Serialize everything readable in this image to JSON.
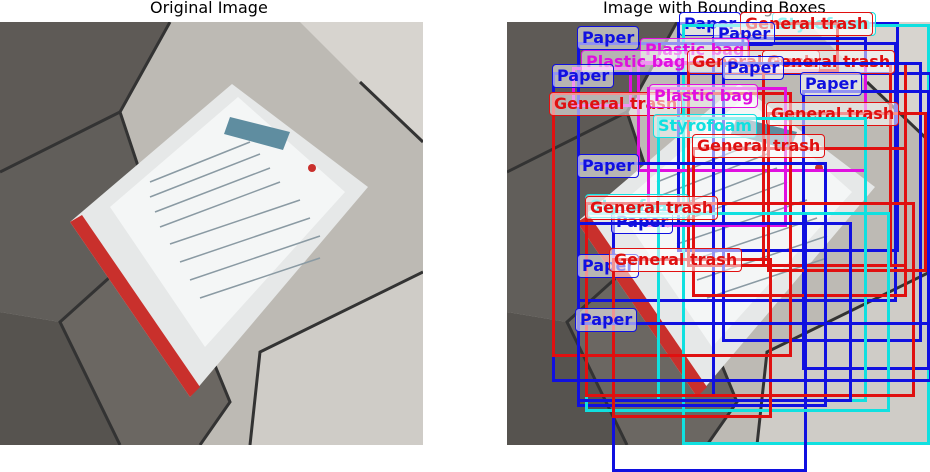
{
  "titles": {
    "left": "Original Image",
    "right": "Image with Bounding Boxes"
  },
  "class_colors": {
    "Paper": "#1010e0",
    "General trash": "#e01010",
    "Plastic bag": "#e010e0",
    "Styrofoam": "#10e0e0"
  },
  "detections": [
    {
      "label": "Paper",
      "color": "#1010e0"
    },
    {
      "label": "Styrofoam",
      "color": "#10e0e0"
    },
    {
      "label": "General trash",
      "color": "#e01010"
    },
    {
      "label": "Paper",
      "color": "#1010e0"
    },
    {
      "label": "Paper",
      "color": "#1010e0"
    },
    {
      "label": "Plastic bag",
      "color": "#e010e0"
    },
    {
      "label": "Plastic bag",
      "color": "#e010e0"
    },
    {
      "label": "Paper",
      "color": "#1010e0"
    },
    {
      "label": "General trash",
      "color": "#e01010"
    },
    {
      "label": "General trash",
      "color": "#e01010"
    },
    {
      "label": "Paper",
      "color": "#1010e0"
    },
    {
      "label": "General trash",
      "color": "#e01010"
    },
    {
      "label": "Paper",
      "color": "#1010e0"
    },
    {
      "label": "Plastic bag",
      "color": "#e010e0"
    },
    {
      "label": "General trash",
      "color": "#e01010"
    },
    {
      "label": "Styrofoam",
      "color": "#10e0e0"
    },
    {
      "label": "General trash",
      "color": "#e01010"
    },
    {
      "label": "Paper",
      "color": "#1010e0"
    },
    {
      "label": "Paper",
      "color": "#1010e0"
    },
    {
      "label": "Styrofoam",
      "color": "#10e0e0"
    },
    {
      "label": "General trash",
      "color": "#e01010"
    },
    {
      "label": "Paper",
      "color": "#1010e0"
    },
    {
      "label": "General trash",
      "color": "#e01010"
    },
    {
      "label": "Paper",
      "color": "#1010e0"
    }
  ]
}
